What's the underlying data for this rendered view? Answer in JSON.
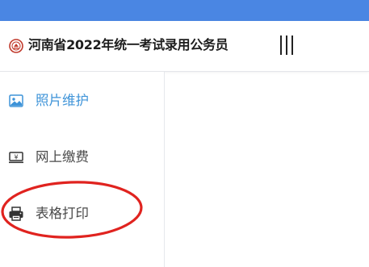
{
  "header": {
    "title": "河南省2022年统一考试录用公务员",
    "logo_icon": "exam-seal-logo-icon",
    "menu_icon": "vertical-bars-menu-icon"
  },
  "sidebar": {
    "items": [
      {
        "label": "照片维护",
        "icon": "image-icon",
        "active": true
      },
      {
        "label": "网上缴费",
        "icon": "yuan-payment-icon",
        "active": false
      },
      {
        "label": "表格打印",
        "icon": "printer-icon",
        "active": false
      }
    ]
  },
  "annotation": {
    "shape": "ellipse",
    "color": "#e0231f",
    "target": "表格打印"
  },
  "colors": {
    "topbar": "#4a86e3",
    "accent": "#3d93d8",
    "text": "#4a4a4a",
    "logo": "#c0392b"
  }
}
